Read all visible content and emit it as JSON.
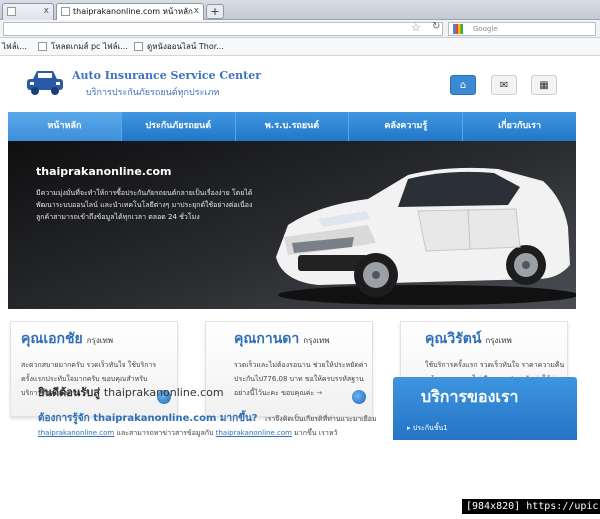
{
  "browser": {
    "tabs": [
      {
        "label": "",
        "active": false
      },
      {
        "label": "thaiprakanonline.com หน้าหลัก",
        "active": true
      }
    ],
    "new_tab": "+",
    "tab_close": "x",
    "search_placeholder": "Google",
    "bookmarks": [
      {
        "label": "ไฟล์เ..."
      },
      {
        "label": "โหลดเกมส์ pc ไฟล์เ..."
      },
      {
        "label": "ดูหนังออนไลน์ Thor..."
      }
    ]
  },
  "header": {
    "title": "Auto Insurance Service Center",
    "subtitle": "บริการประกันภัยรถยนต์ทุกประเภท"
  },
  "menu": [
    {
      "label": "หน้าหลัก",
      "active": true
    },
    {
      "label": "ประกันภัยรถยนต์",
      "active": false
    },
    {
      "label": "พ.ร.บ.รถยนต์",
      "active": false
    },
    {
      "label": "คลังความรู้",
      "active": false
    },
    {
      "label": "เกี่ยวกับเรา",
      "active": false
    }
  ],
  "hero": {
    "title": "thaiprakanonline.com",
    "text": "มีความมุ่งมั่นที่จะทำให้การซื้อประกันภัยรถยนต์กลายเป็นเรื่องง่าย โดยได้พัฒนาระบบออนไลน์ และนำเทคโนโลยีต่างๆ มาประยุกต์ใช้อย่างต่อเนื่อง ลูกค้าสามารถเข้าถึงข้อมูลได้ทุกเวลา ตลอด 24 ชั่วโมง"
  },
  "testimonials": [
    {
      "name": "คุณเอกชัย",
      "location": "กรุงเทพ",
      "text": "สะดวกสบายมากครับ รวดเร็วทันใจ ใช้บริการครั้งแรกประทับใจมากครับ ขอบคุณสำหรับบริการที่สุดยอดครับ",
      "more": "→"
    },
    {
      "name": "คุณกานดา",
      "location": "กรุงเทพ",
      "text": "รวดเร็วและไม่ต้องรอนาน ช่วยให้ประหยัดค่าประกันไป776.08 บาท ขอให้ครบรรหัสฐานอย่างนี้ไว้นะคะ ขอบคุณค่ะ",
      "more": "→"
    },
    {
      "name": "คุณวิรัตน์",
      "location": "กรุงเทพ",
      "text": "ใช้บริการครั้งแรก รวดเร็วทันใจ ราคาความคืนหน้าตลอดเวลา ไม่เสียเวลา ประหยัดค่าใช้จ่าย มั่นใจในบริการ",
      "more": "→"
    }
  ],
  "welcome": {
    "prefix": "ยินดีต้อนรับสู่",
    "domain": "thaiprakanonline.com"
  },
  "faq": {
    "question": "ต้องการรู้จัก thaiprakanonline.com มากขึ้น?",
    "rest": "เราจึงคิดเป็นเกียรติที่ท่านแวะมาเยือม",
    "line2_link1": "thaiprakanonline.com",
    "line2_text": " และสามารถหาข่าวสารข้อมูลกับ ",
    "line2_link2": "thaiprakanonline.com",
    "line2_tail": " มากขึ้น เราหวังว่าท่านจะได้"
  },
  "services": {
    "heading": "บริการของเรา",
    "item": "ประกันชั้น1"
  },
  "watermark": "[984x820] https://upic.me/",
  "colors": {
    "accent": "#2f6fb8",
    "menu": "#2376c8",
    "hero_bg": "#1c1d20"
  },
  "icons": [
    "home-icon",
    "mail-icon",
    "sitemap-icon",
    "car-logo-icon",
    "star-icon",
    "reload-icon",
    "google-icon"
  ]
}
